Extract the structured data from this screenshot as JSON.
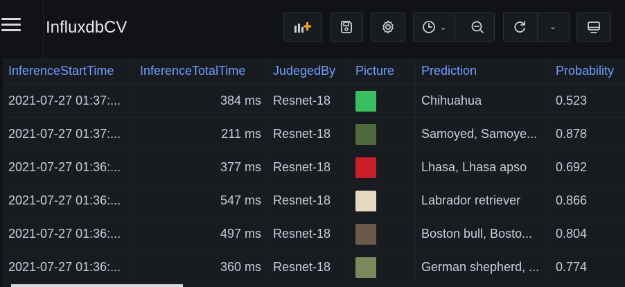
{
  "header": {
    "title": "InfluxdbCV"
  },
  "toolbar": {
    "icons": [
      "add-panel-icon",
      "save-icon",
      "settings-icon",
      "time-picker-icon",
      "zoom-out-icon",
      "refresh-icon",
      "chevron-down-icon",
      "tv-mode-icon"
    ]
  },
  "table": {
    "columns": [
      "InferenceStartTime",
      "InferenceTotalTime",
      "JudegedBy",
      "Picture",
      "Prediction",
      "Probability"
    ],
    "rows": [
      {
        "start": "2021-07-27 01:37:...",
        "total": "384 ms",
        "judged": "Resnet-18",
        "picture_color": "#3bbf63",
        "prediction": "Chihuahua",
        "probability": "0.523"
      },
      {
        "start": "2021-07-27 01:37:...",
        "total": "211 ms",
        "judged": "Resnet-18",
        "picture_color": "#4f6b3d",
        "prediction": "Samoyed, Samoye...",
        "probability": "0.878"
      },
      {
        "start": "2021-07-27 01:36:...",
        "total": "377 ms",
        "judged": "Resnet-18",
        "picture_color": "#c8202a",
        "prediction": "Lhasa, Lhasa apso",
        "probability": "0.692"
      },
      {
        "start": "2021-07-27 01:36:...",
        "total": "547 ms",
        "judged": "Resnet-18",
        "picture_color": "#e6d9c4",
        "prediction": "Labrador retriever",
        "probability": "0.866"
      },
      {
        "start": "2021-07-27 01:36:...",
        "total": "497 ms",
        "judged": "Resnet-18",
        "picture_color": "#6b5a4a",
        "prediction": "Boston bull, Bosto...",
        "probability": "0.804"
      },
      {
        "start": "2021-07-27 01:36:...",
        "total": "360 ms",
        "judged": "Resnet-18",
        "picture_color": "#7a8a5a",
        "prediction": "German shepherd, ...",
        "probability": "0.774"
      }
    ]
  }
}
